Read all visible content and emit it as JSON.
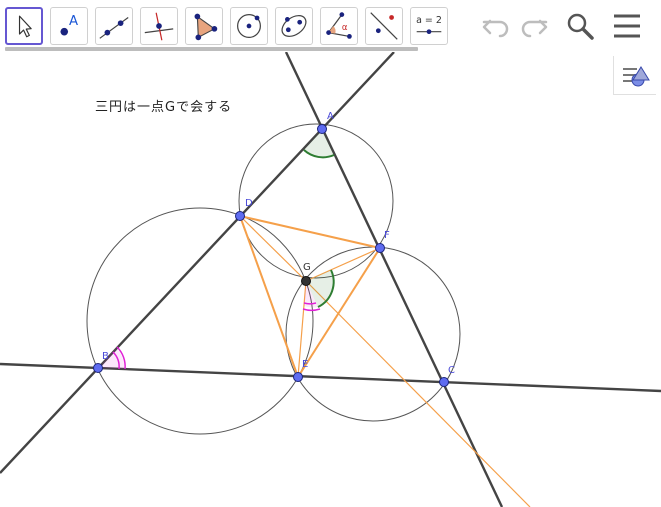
{
  "toolbar": {
    "tools": [
      {
        "id": "move",
        "icon": "move-arrow-icon",
        "selected": true
      },
      {
        "id": "point",
        "icon": "point-icon",
        "glyph": "A"
      },
      {
        "id": "line",
        "icon": "line-icon"
      },
      {
        "id": "perpendicular",
        "icon": "perpendicular-line-icon"
      },
      {
        "id": "polygon",
        "icon": "polygon-icon"
      },
      {
        "id": "circle",
        "icon": "circle-center-point-icon"
      },
      {
        "id": "conic",
        "icon": "ellipse-icon"
      },
      {
        "id": "angle",
        "icon": "angle-icon",
        "glyph": "α"
      },
      {
        "id": "reflect",
        "icon": "reflect-icon"
      },
      {
        "id": "slider",
        "icon": "slider-icon",
        "glyph": "a = 2"
      }
    ],
    "undo_icon": "undo-icon",
    "redo_icon": "redo-icon",
    "search_icon": "search-icon",
    "menu_icon": "menu-icon"
  },
  "style_bar_icon": "style-bar-toggle-icon",
  "caption": "三円は一点Gで会する",
  "points": {
    "A": "A",
    "B": "B",
    "C": "C",
    "D": "D",
    "E": "E",
    "F": "F",
    "G": "G"
  },
  "colors": {
    "selected_border": "#6557d2",
    "point_fill": "#5f6cf0",
    "point_label": "#4a4ad8",
    "line": "#444444",
    "circle": "#555555",
    "orange": "#f5a04a",
    "green_angle": "#2e7d32",
    "magenta_angle": "#e021d6",
    "icon_grey": "#bdbdbd",
    "icon_dark": "#555555"
  }
}
